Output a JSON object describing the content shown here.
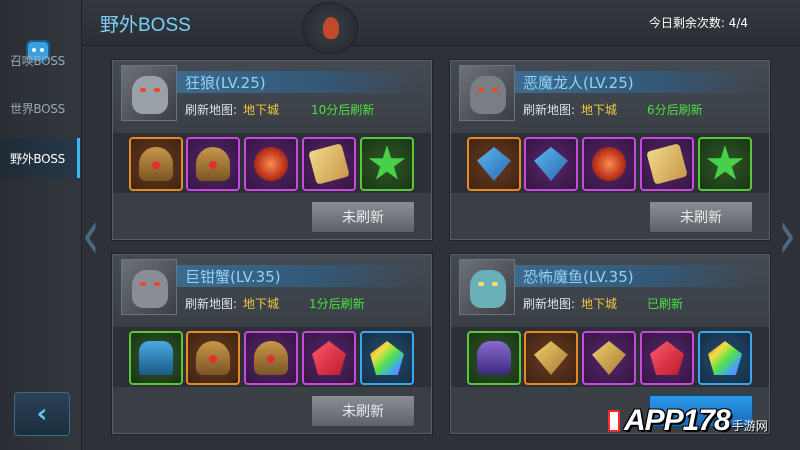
{
  "sidebar": {
    "items": [
      {
        "label": "召唤BOSS",
        "active": false
      },
      {
        "label": "世界BOSS",
        "active": false
      },
      {
        "label": "野外BOSS",
        "active": true
      }
    ],
    "back_icon": "chevron-left-icon"
  },
  "header": {
    "title": "野外BOSS",
    "counter": "今日剩余次数:  4/4"
  },
  "bosses": [
    {
      "name": "狂狼(LV.25)",
      "map_label": "刷新地图:",
      "map_name": "地下城",
      "timer": "10分后刷新",
      "button": "未刷新",
      "items": [
        "helmet-orange",
        "helmet-purple",
        "orb-purple",
        "scroll-purple",
        "star-green"
      ]
    },
    {
      "name": "恶魔龙人(LV.25)",
      "map_label": "刷新地图:",
      "map_name": "地下城",
      "timer": "6分后刷新",
      "button": "未刷新",
      "items": [
        "amulet-orange",
        "amulet-purple",
        "orb-purple",
        "scroll-purple",
        "star-green"
      ]
    },
    {
      "name": "巨钳蟹(LV.35)",
      "map_label": "刷新地图:",
      "map_name": "地下城",
      "timer": "1分后刷新",
      "button": "未刷新",
      "items": [
        "armor-green",
        "helmet-orange",
        "helmet-purple",
        "gem-purple",
        "rainbow-gem-blue"
      ]
    },
    {
      "name": "恐怖魔鱼(LV.35)",
      "map_label": "刷新地图:",
      "map_name": "地下城",
      "timer": "已刷新",
      "button": "",
      "items": [
        "creature-green",
        "amulet-gold-orange",
        "amulet-gold-purple",
        "gem-purple",
        "rainbow-gem-blue"
      ]
    }
  ],
  "watermark": {
    "brand": "APP178",
    "sub": "手游网"
  },
  "colors": {
    "accent": "#38b8f0",
    "timer_green": "#4de040",
    "map_gold": "#f0c840"
  }
}
